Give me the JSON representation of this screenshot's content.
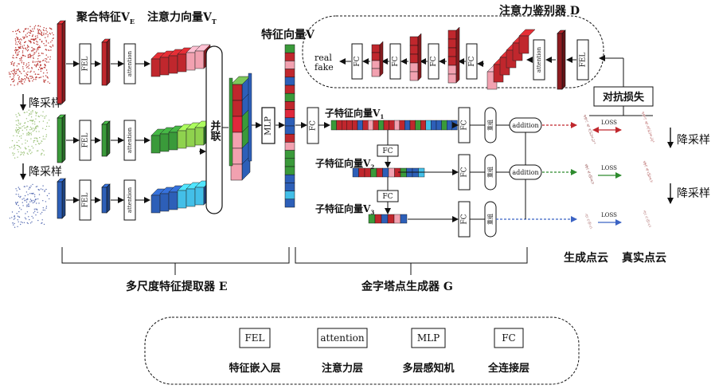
{
  "title_aggregate_feature": "聚合特征V",
  "title_aggregate_sub": "E",
  "title_attention_vector": "注意力向量V",
  "title_attention_sub": "T",
  "title_feature_vector": "特征向量V",
  "title_discriminator": "注意力鉴别器 D",
  "downsample_label": "降采样",
  "concat_label": "并联",
  "label_real": "real",
  "label_fake": "fake",
  "adversarial_loss": "对抗损失",
  "sub_vector_1": "子特征向量V",
  "sub_vector_1_sub": "1",
  "sub_vector_2": "子特征向量V",
  "sub_vector_2_sub": "2",
  "sub_vector_3": "子特征向量V",
  "sub_vector_3_sub": "3",
  "reshape_label": "重组",
  "addition_label": "addition",
  "loss_label": "LOSS",
  "generated_cloud": "生成点云",
  "real_cloud": "真实点云",
  "extractor_label": "多尺度特征提取器 E",
  "generator_label": "金字塔点生成器 G",
  "module_labels": {
    "fel": "FEL",
    "attention": "attention",
    "mlp": "MLP",
    "fc": "FC"
  },
  "legend": [
    {
      "box": "FEL",
      "desc": "特征嵌入层"
    },
    {
      "box": "attention",
      "desc": "注意力层"
    },
    {
      "box": "MLP",
      "desc": "多层感知机"
    },
    {
      "box": "FC",
      "desc": "全连接层"
    }
  ],
  "colors": {
    "red": "#c0272d",
    "red_dark": "#8e1b20",
    "pink": "#f2a1b0",
    "green": "#3a9a3a",
    "green_light": "#8fd24e",
    "blue": "#2d5fb8",
    "blue_light": "#43bfe8",
    "arrow_red": "#c0272d",
    "arrow_green": "#2e8b2e",
    "arrow_blue": "#3b63c4"
  }
}
